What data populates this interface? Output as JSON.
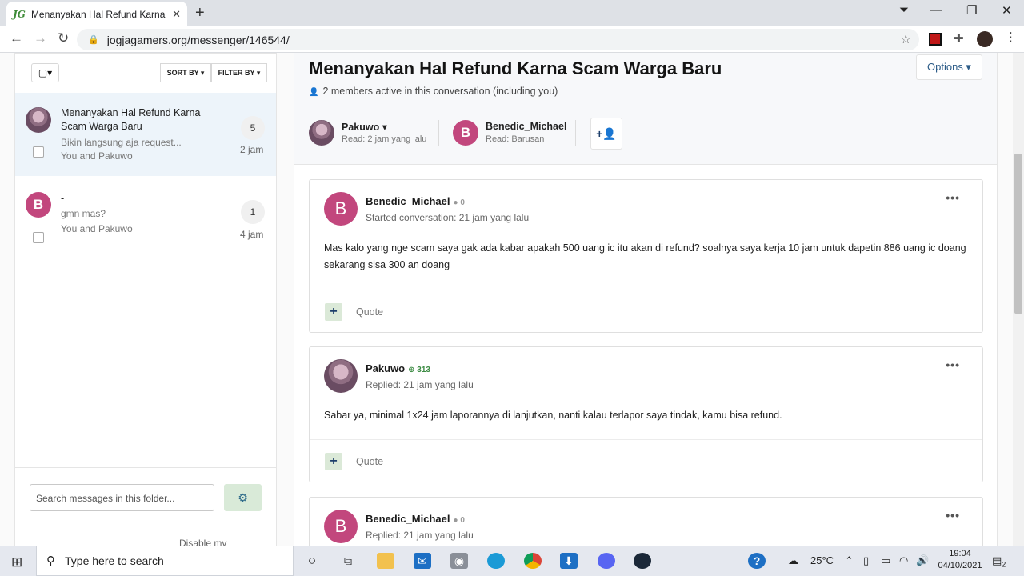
{
  "browser": {
    "tab_title": "Menanyakan Hal Refund Karna Sc",
    "tab_favicon": "JG",
    "url": "jogjagamers.org/messenger/146544/"
  },
  "sidebar": {
    "sort_label": "SORT BY ▾",
    "filter_label": "FILTER BY ▾",
    "conversations": [
      {
        "title": "Menanyakan Hal Refund Karna Scam Warga Baru",
        "preview": "Bikin langsung aja request...",
        "participants": "You and Pakuwo",
        "count": "5",
        "time": "2 jam"
      },
      {
        "title": "-",
        "avatar_letter": "B",
        "preview": "gmn mas?",
        "participants": "You and Pakuwo",
        "count": "1",
        "time": "4 jam"
      }
    ],
    "search_placeholder": "Search messages in this folder...",
    "disable_link": "Disable my messenger"
  },
  "conversation": {
    "title": "Menanyakan Hal Refund Karna Scam Warga Baru",
    "members_text": "2 members active in this conversation (including you)",
    "options_label": "Options ▾",
    "participants": [
      {
        "name": "Pakuwo ▾",
        "read": "Read: 2 jam yang lalu"
      },
      {
        "name": "Benedic_Michael",
        "avatar_letter": "B",
        "read": "Read: Barusan"
      }
    ],
    "messages": [
      {
        "author": "Benedic_Michael",
        "avatar_letter": "B",
        "score": "0",
        "meta": "Started conversation: 21 jam yang lalu",
        "body": "Mas kalo yang nge scam saya gak ada kabar apakah 500 uang ic itu akan di refund? soalnya saya kerja 10 jam untuk dapetin 886 uang ic doang sekarang sisa 300 an doang",
        "quote_label": "Quote"
      },
      {
        "author": "Pakuwo",
        "score": "313",
        "meta": "Replied: 21 jam yang lalu",
        "body": "Sabar ya, minimal 1x24 jam laporannya di lanjutkan, nanti kalau terlapor saya tindak, kamu bisa refund.",
        "quote_label": "Quote"
      },
      {
        "author": "Benedic_Michael",
        "avatar_letter": "B",
        "score": "0",
        "meta": "Replied: 21 jam yang lalu"
      }
    ]
  },
  "taskbar": {
    "search_placeholder": "Type here to search",
    "temperature": "25°C",
    "time": "19:04",
    "date": "04/10/2021",
    "notification_count": "2"
  },
  "colors": {
    "accent_blue": "#2d5c88",
    "avatar_pink": "#c2477d",
    "positive_green": "#3c8b43"
  }
}
